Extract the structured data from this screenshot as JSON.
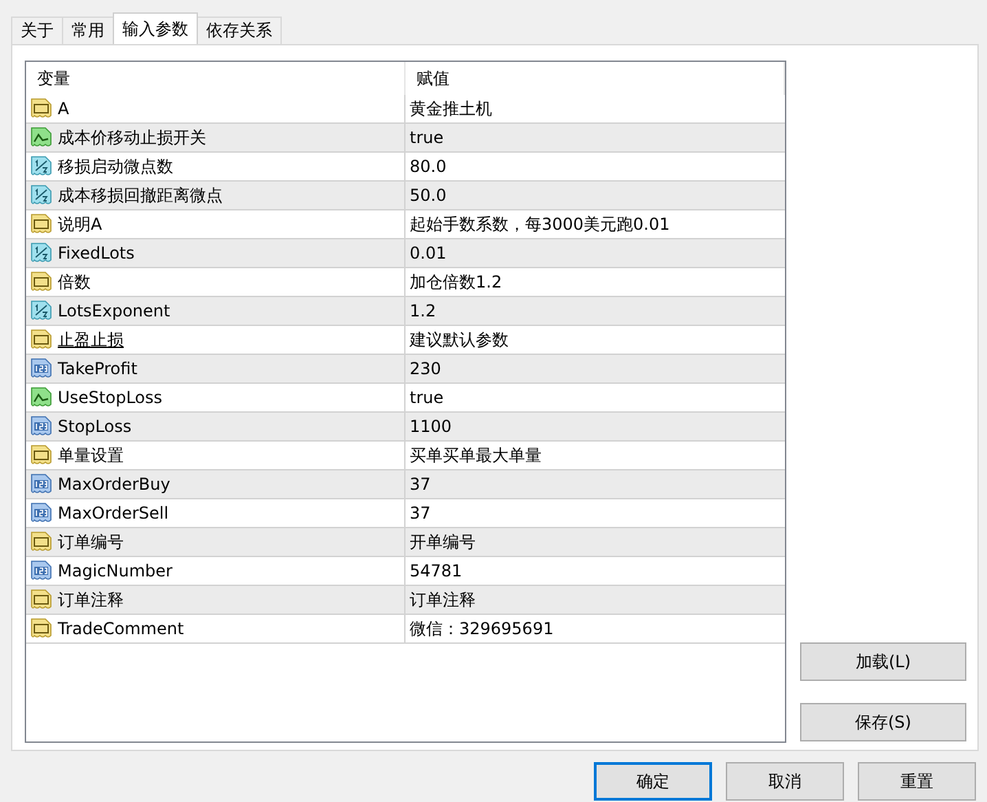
{
  "tabs": [
    {
      "label": "关于",
      "selected": false
    },
    {
      "label": "常用",
      "selected": false
    },
    {
      "label": "输入参数",
      "selected": true
    },
    {
      "label": "依存关系",
      "selected": false
    }
  ],
  "table": {
    "columns": [
      "变量",
      "赋值"
    ],
    "rows": [
      {
        "kind": "string",
        "name": "A",
        "value": "黄金推土机",
        "underline": false
      },
      {
        "kind": "bool",
        "name": "成本价移动止损开关",
        "value": "true",
        "underline": false
      },
      {
        "kind": "double",
        "name": "移损启动微点数",
        "value": "80.0",
        "underline": false
      },
      {
        "kind": "double",
        "name": "成本移损回撤距离微点",
        "value": "50.0",
        "underline": false
      },
      {
        "kind": "string",
        "name": "说明A",
        "value": "起始手数系数，每3000美元跑0.01",
        "underline": false
      },
      {
        "kind": "double",
        "name": "FixedLots",
        "value": "0.01",
        "underline": false
      },
      {
        "kind": "string",
        "name": "倍数",
        "value": "加仓倍数1.2",
        "underline": false
      },
      {
        "kind": "double",
        "name": "LotsExponent",
        "value": "1.2",
        "underline": false
      },
      {
        "kind": "string",
        "name": "止盈止损",
        "value": "建议默认参数",
        "underline": true
      },
      {
        "kind": "int",
        "name": "TakeProfit",
        "value": "230",
        "underline": false
      },
      {
        "kind": "bool",
        "name": "UseStopLoss",
        "value": "true",
        "underline": false
      },
      {
        "kind": "int",
        "name": "StopLoss",
        "value": "1100",
        "underline": false
      },
      {
        "kind": "string",
        "name": "单量设置",
        "value": "买单买单最大单量",
        "underline": false
      },
      {
        "kind": "int",
        "name": "MaxOrderBuy",
        "value": "37",
        "underline": false
      },
      {
        "kind": "int",
        "name": "MaxOrderSell",
        "value": "37",
        "underline": false
      },
      {
        "kind": "string",
        "name": "订单编号",
        "value": "开单编号",
        "underline": false
      },
      {
        "kind": "int",
        "name": "MagicNumber",
        "value": "54781",
        "underline": false
      },
      {
        "kind": "string",
        "name": "订单注释",
        "value": "订单注释",
        "underline": false
      },
      {
        "kind": "string",
        "name": "TradeComment",
        "value": "微信：329695691",
        "underline": false
      }
    ]
  },
  "side_buttons": [
    "加载(L)",
    "保存(S)"
  ],
  "footer_buttons": [
    {
      "label": "确定",
      "default": true
    },
    {
      "label": "取消",
      "default": false
    },
    {
      "label": "重置",
      "default": false
    }
  ]
}
